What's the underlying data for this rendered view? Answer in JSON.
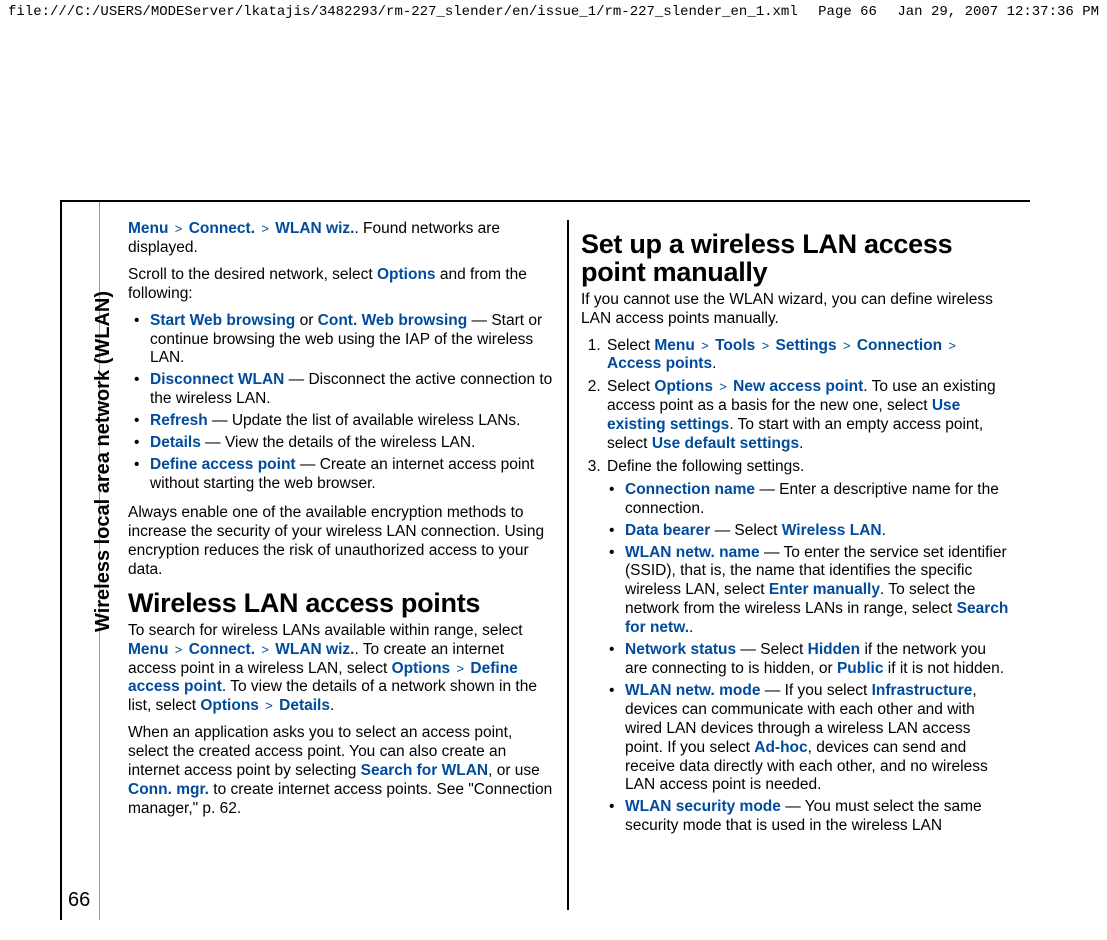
{
  "header": {
    "path": "file:///C:/USERS/MODEServer/lkatajis/3482293/rm-227_slender/en/issue_1/rm-227_slender_en_1.xml",
    "page": "Page 66",
    "timestamp": "Jan 29, 2007 12:37:36 PM"
  },
  "sidebar": {
    "label": "Wireless local area network (WLAN)",
    "page_number": "66"
  },
  "left": {
    "p1a": "Menu",
    "p1b": "Connect.",
    "p1c": "WLAN wiz.",
    "p1d": ". Found networks are displayed.",
    "p2a": "Scroll to the desired network, select ",
    "p2b": "Options",
    "p2c": " and from the following:",
    "items": [
      {
        "label": "Start Web browsing",
        "mid": " or ",
        "label2": "Cont. Web browsing",
        "desc": " — Start or continue browsing the web using the IAP of the wireless LAN."
      },
      {
        "label": "Disconnect WLAN",
        "desc": " — Disconnect the active connection to the wireless LAN."
      },
      {
        "label": "Refresh",
        "desc": " — Update the list of available wireless LANs."
      },
      {
        "label": "Details",
        "desc": " — View the details of the wireless LAN."
      },
      {
        "label": "Define access point",
        "desc": " — Create an internet access point without starting the web browser."
      }
    ],
    "p3": "Always enable one of the available encryption methods to increase the security of your wireless LAN connection. Using encryption reduces the risk of unauthorized access to your data.",
    "h1": "Wireless LAN access points",
    "p4a": "To search for wireless LANs available within range, select ",
    "p4_menu": "Menu",
    "p4_conn": "Connect.",
    "p4_wiz": "WLAN wiz.",
    "p4b": ". To create an internet access point in a wireless LAN, select ",
    "p4_opt": "Options",
    "p4_def": "Define access point",
    "p4c": ". To view the details of a network shown in the list, select ",
    "p4_opt2": "Options",
    "p4_det": "Details",
    "p4d": ".",
    "p5a": "When an application asks you to select an access point, select the created access point. You can also create an internet access point by selecting ",
    "p5_sfw": "Search for WLAN",
    "p5b": ", or use ",
    "p5_cmgr": "Conn. mgr.",
    "p5c": " to create internet access points. See \"Connection manager,\" p. 62."
  },
  "right": {
    "h1": "Set up a wireless LAN access point manually",
    "p1": "If you cannot use the WLAN wizard, you can define wireless LAN access points manually.",
    "step1a": "Select ",
    "step1_menu": "Menu",
    "step1_tools": "Tools",
    "step1_settings": "Settings",
    "step1_conn": "Connection",
    "step1_ap": "Access points",
    "step1b": ".",
    "step2a": "Select ",
    "step2_opt": "Options",
    "step2_nap": "New access point",
    "step2b": ". To use an existing access point as a basis for the new one, select ",
    "step2_ues": "Use existing settings",
    "step2c": ". To start with an empty access point, select ",
    "step2_uds": "Use default settings",
    "step2d": ".",
    "step3": "Define the following settings.",
    "settings": [
      {
        "label": "Connection name",
        "desc": " — Enter a descriptive name for the connection."
      },
      {
        "label": "Data bearer",
        "desc_pre": " — Select ",
        "opt": "Wireless LAN",
        "desc_post": "."
      },
      {
        "label": "WLAN netw. name",
        "desc_pre": " — To enter the service set identifier (SSID), that is, the name that identifies the specific wireless LAN, select ",
        "opt": "Enter manually",
        "desc_mid": ". To select the network from the wireless LANs in range, select ",
        "opt2": "Search for netw.",
        "desc_post": "."
      },
      {
        "label": "Network status",
        "desc_pre": " — Select ",
        "opt": "Hidden",
        "desc_mid": " if the network you are connecting to is hidden, or ",
        "opt2": "Public",
        "desc_post": " if it is not hidden."
      },
      {
        "label": "WLAN netw. mode",
        "desc_pre": " — If you select ",
        "opt": "Infrastructure",
        "desc_mid": ", devices can communicate with each other and with wired LAN devices through a wireless LAN access point. If you select ",
        "opt2": "Ad-hoc",
        "desc_post": ", devices can send and receive data directly with each other, and no wireless LAN access point is needed."
      },
      {
        "label": "WLAN security mode",
        "desc": " — You must select the same security mode that is used in the wireless LAN"
      }
    ]
  },
  "gt": ">"
}
